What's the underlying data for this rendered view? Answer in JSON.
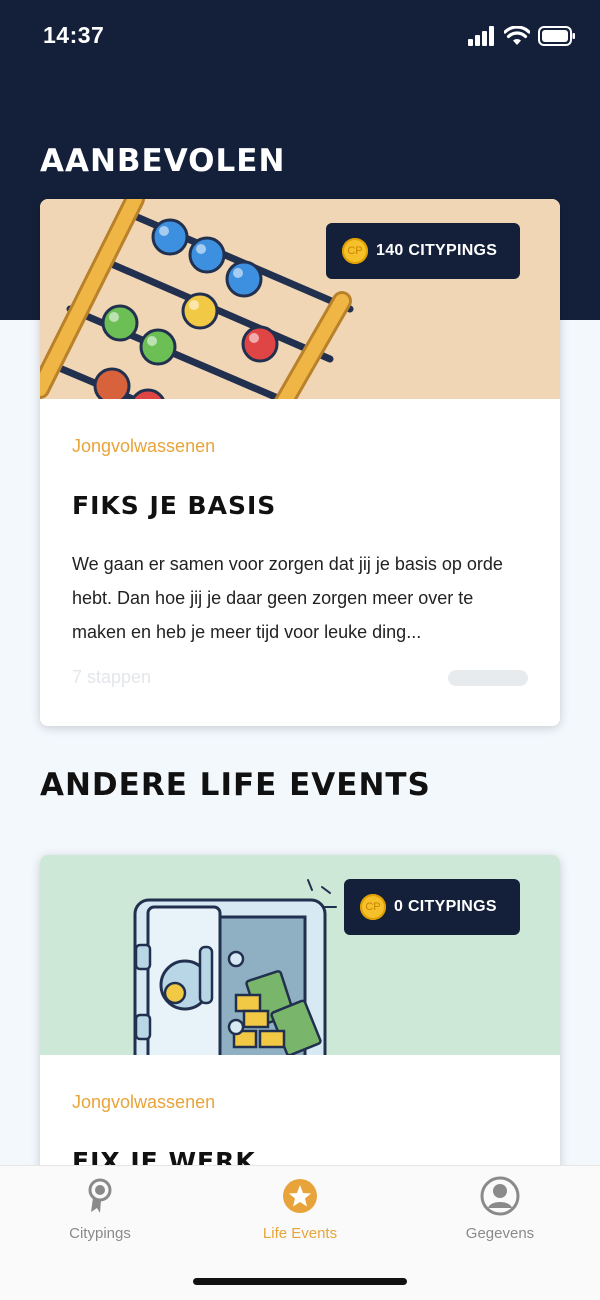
{
  "status_bar": {
    "time": "14:37"
  },
  "sections": {
    "recommended_title": "AANBEVOLEN",
    "others_title": "ANDERE LIFE EVENTS"
  },
  "cards": [
    {
      "reward": "140 CITYPINGS",
      "coin_label": "CP",
      "category": "Jongvolwassenen",
      "title": "FIKS JE BASIS",
      "description": "We gaan er samen voor zorgen dat jij je basis op orde hebt. Dan hoe jij je daar geen zorgen meer over te maken en heb je meer tijd voor leuke ding...",
      "steps": "7 stappen",
      "progress": 0
    },
    {
      "reward": "0 CITYPINGS",
      "coin_label": "CP",
      "category": "Jongvolwassenen",
      "title": "FIX JE WERK"
    }
  ],
  "tab_bar": {
    "tabs": [
      {
        "label": "Citypings",
        "icon": "medal-icon",
        "active": false
      },
      {
        "label": "Life Events",
        "icon": "star-icon",
        "active": true
      },
      {
        "label": "Gegevens",
        "icon": "user-icon",
        "active": false
      }
    ]
  },
  "colors": {
    "navy": "#14203a",
    "accent": "#e8a43a",
    "background": "#f3f8fd"
  }
}
